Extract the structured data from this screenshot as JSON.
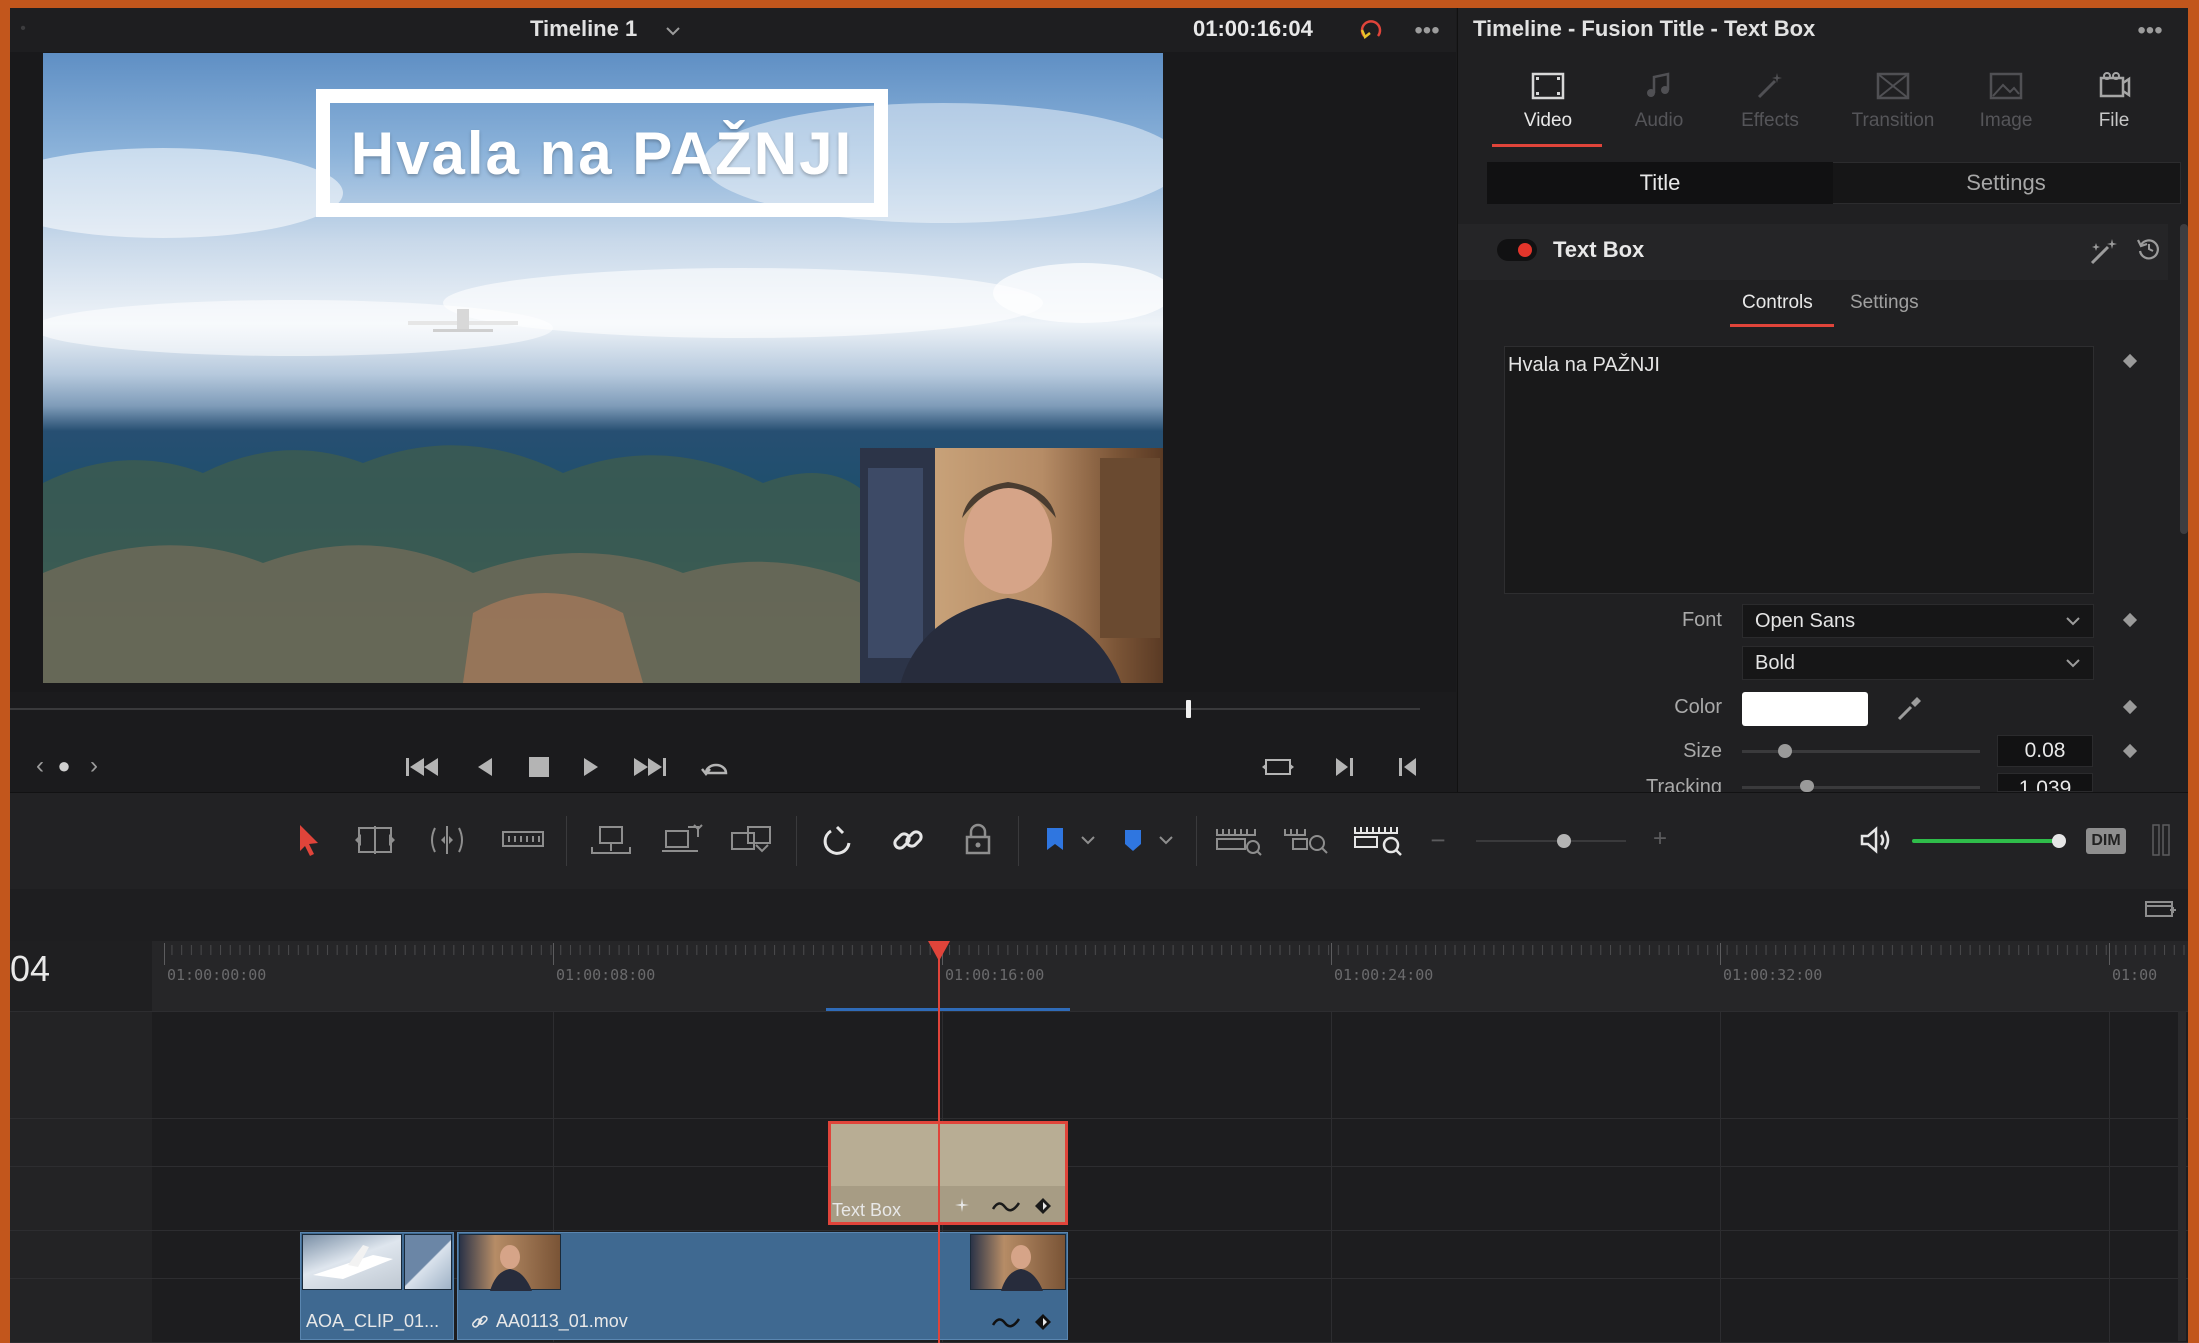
{
  "viewer": {
    "timeline_name": "Timeline 1",
    "timecode": "01:00:16:04",
    "title_overlay_text": "Hvala na PAŽNJI"
  },
  "inspector": {
    "title": "Timeline - Fusion Title - Text Box",
    "tabs": [
      {
        "label": "Video",
        "icon": "video-icon",
        "active": true
      },
      {
        "label": "Audio",
        "icon": "audio-icon",
        "active": false
      },
      {
        "label": "Effects",
        "icon": "effects-icon",
        "active": false
      },
      {
        "label": "Transition",
        "icon": "transition-icon",
        "active": false
      },
      {
        "label": "Image",
        "icon": "image-icon",
        "active": false
      },
      {
        "label": "File",
        "icon": "file-icon",
        "active": false
      }
    ],
    "segments": {
      "title": "Title",
      "settings": "Settings"
    },
    "section": {
      "name": "Text Box"
    },
    "subtabs": {
      "controls": "Controls",
      "settings": "Settings"
    },
    "text_value": "Hvala na PAŽNJI",
    "font": {
      "label": "Font",
      "family": "Open Sans",
      "style": "Bold"
    },
    "color": {
      "label": "Color",
      "value": "#ffffff"
    },
    "size": {
      "label": "Size",
      "value": "0.08"
    },
    "tracking": {
      "label": "Tracking",
      "value": "1.039"
    }
  },
  "timeline": {
    "timecode_short": "04",
    "ruler": [
      "01:00:00:00",
      "01:00:08:00",
      "01:00:16:00",
      "01:00:24:00",
      "01:00:32:00",
      "01:00"
    ],
    "clips": {
      "title_clip": "Text Box",
      "clip1": "AOA_CLIP_01...",
      "clip2": "AA0113_01.mov"
    },
    "dim_label": "DIM"
  },
  "colors": {
    "accent_red": "#e0443a",
    "clip_blue": "#3f6991",
    "title_clip": "#b8ad94",
    "audio_green": "#2fbd4a",
    "flag_blue": "#2f76e0",
    "background_orange": "#c2561c"
  }
}
